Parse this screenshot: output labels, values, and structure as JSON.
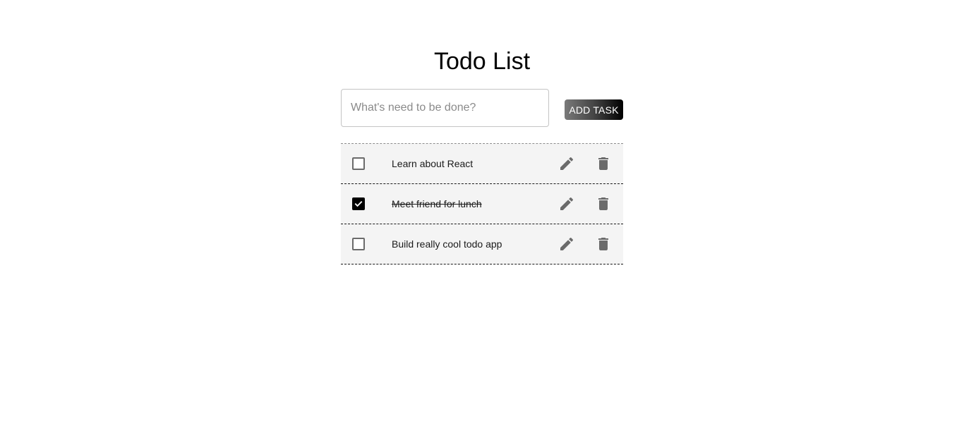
{
  "header": {
    "title": "Todo List"
  },
  "new_task": {
    "placeholder": "What's need to be done?",
    "value": "",
    "add_label": "ADD TASK"
  },
  "tasks": [
    {
      "text": "Learn about React",
      "completed": false
    },
    {
      "text": "Meet friend for lunch",
      "completed": true
    },
    {
      "text": "Build really cool todo app",
      "completed": false
    }
  ],
  "icons": {
    "edit": "pencil-icon",
    "delete": "trash-icon",
    "check": "checkmark-icon"
  },
  "colors": {
    "icon": "#6b6b6b",
    "row_background": "#f4f4f4",
    "checked_box": "#000000"
  }
}
